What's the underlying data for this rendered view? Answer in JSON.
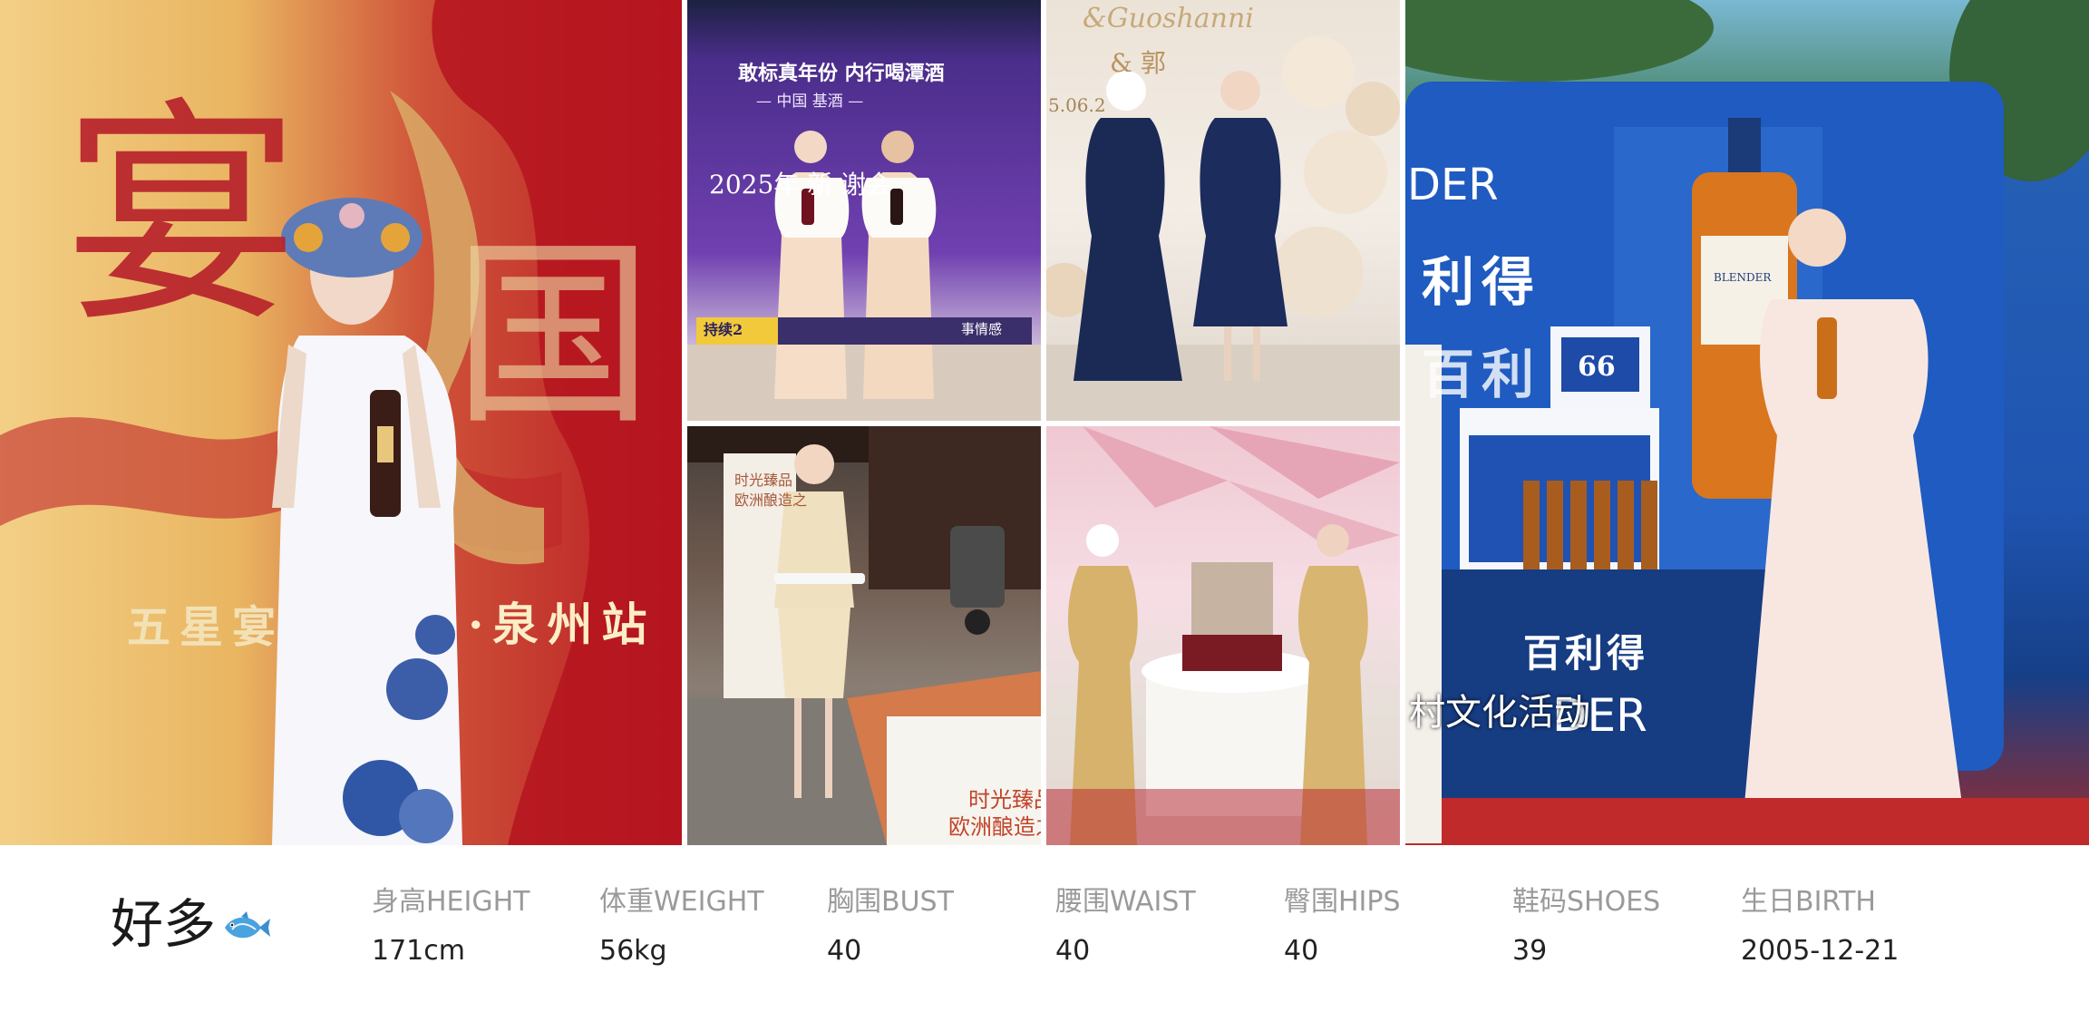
{
  "photos": {
    "p1": {
      "big_chars": "宴",
      "big_chars_2": "国",
      "caption_left": "五星宴",
      "caption_right": "·泉州站"
    },
    "p2": {
      "slogan": "敢标真年份 内行喝潭酒",
      "sub": "— 中国    基酒    —",
      "title": "2025年       新       谢会",
      "banner": "持续2",
      "banner_right": "事情感"
    },
    "p3": {
      "script_text": "&Guoshanni",
      "names": "& 郭",
      "date": "5.06.2"
    },
    "p4": {
      "poster_line1": "时光臻品",
      "poster_line2": "欧洲酿造之",
      "table_line1": "时光臻品",
      "table_line2": "欧洲酿造之"
    },
    "p6": {
      "brand_en": "DER",
      "brand_cn_1": "利得",
      "brand_cn_2": "百利",
      "bottle_label": "BLENDER",
      "box_label": "66",
      "bottom_cn": "百利得",
      "bottom_en": "DER",
      "overlay": "村文化活动"
    }
  },
  "profile": {
    "name": "好多",
    "name_icon": "fish-icon",
    "stats": [
      {
        "label": "身高HEIGHT",
        "value": "171cm"
      },
      {
        "label": "体重WEIGHT",
        "value": "56kg"
      },
      {
        "label": "胸围BUST",
        "value": "40"
      },
      {
        "label": "腰围WAIST",
        "value": "40"
      },
      {
        "label": "臀围HIPS",
        "value": "40"
      },
      {
        "label": "鞋码SHOES",
        "value": "39"
      },
      {
        "label": "生日BIRTH",
        "value": "2005-12-21"
      }
    ]
  },
  "colors": {
    "label": "#9a9a9a",
    "value": "#222222",
    "name": "#1a1a1a"
  }
}
